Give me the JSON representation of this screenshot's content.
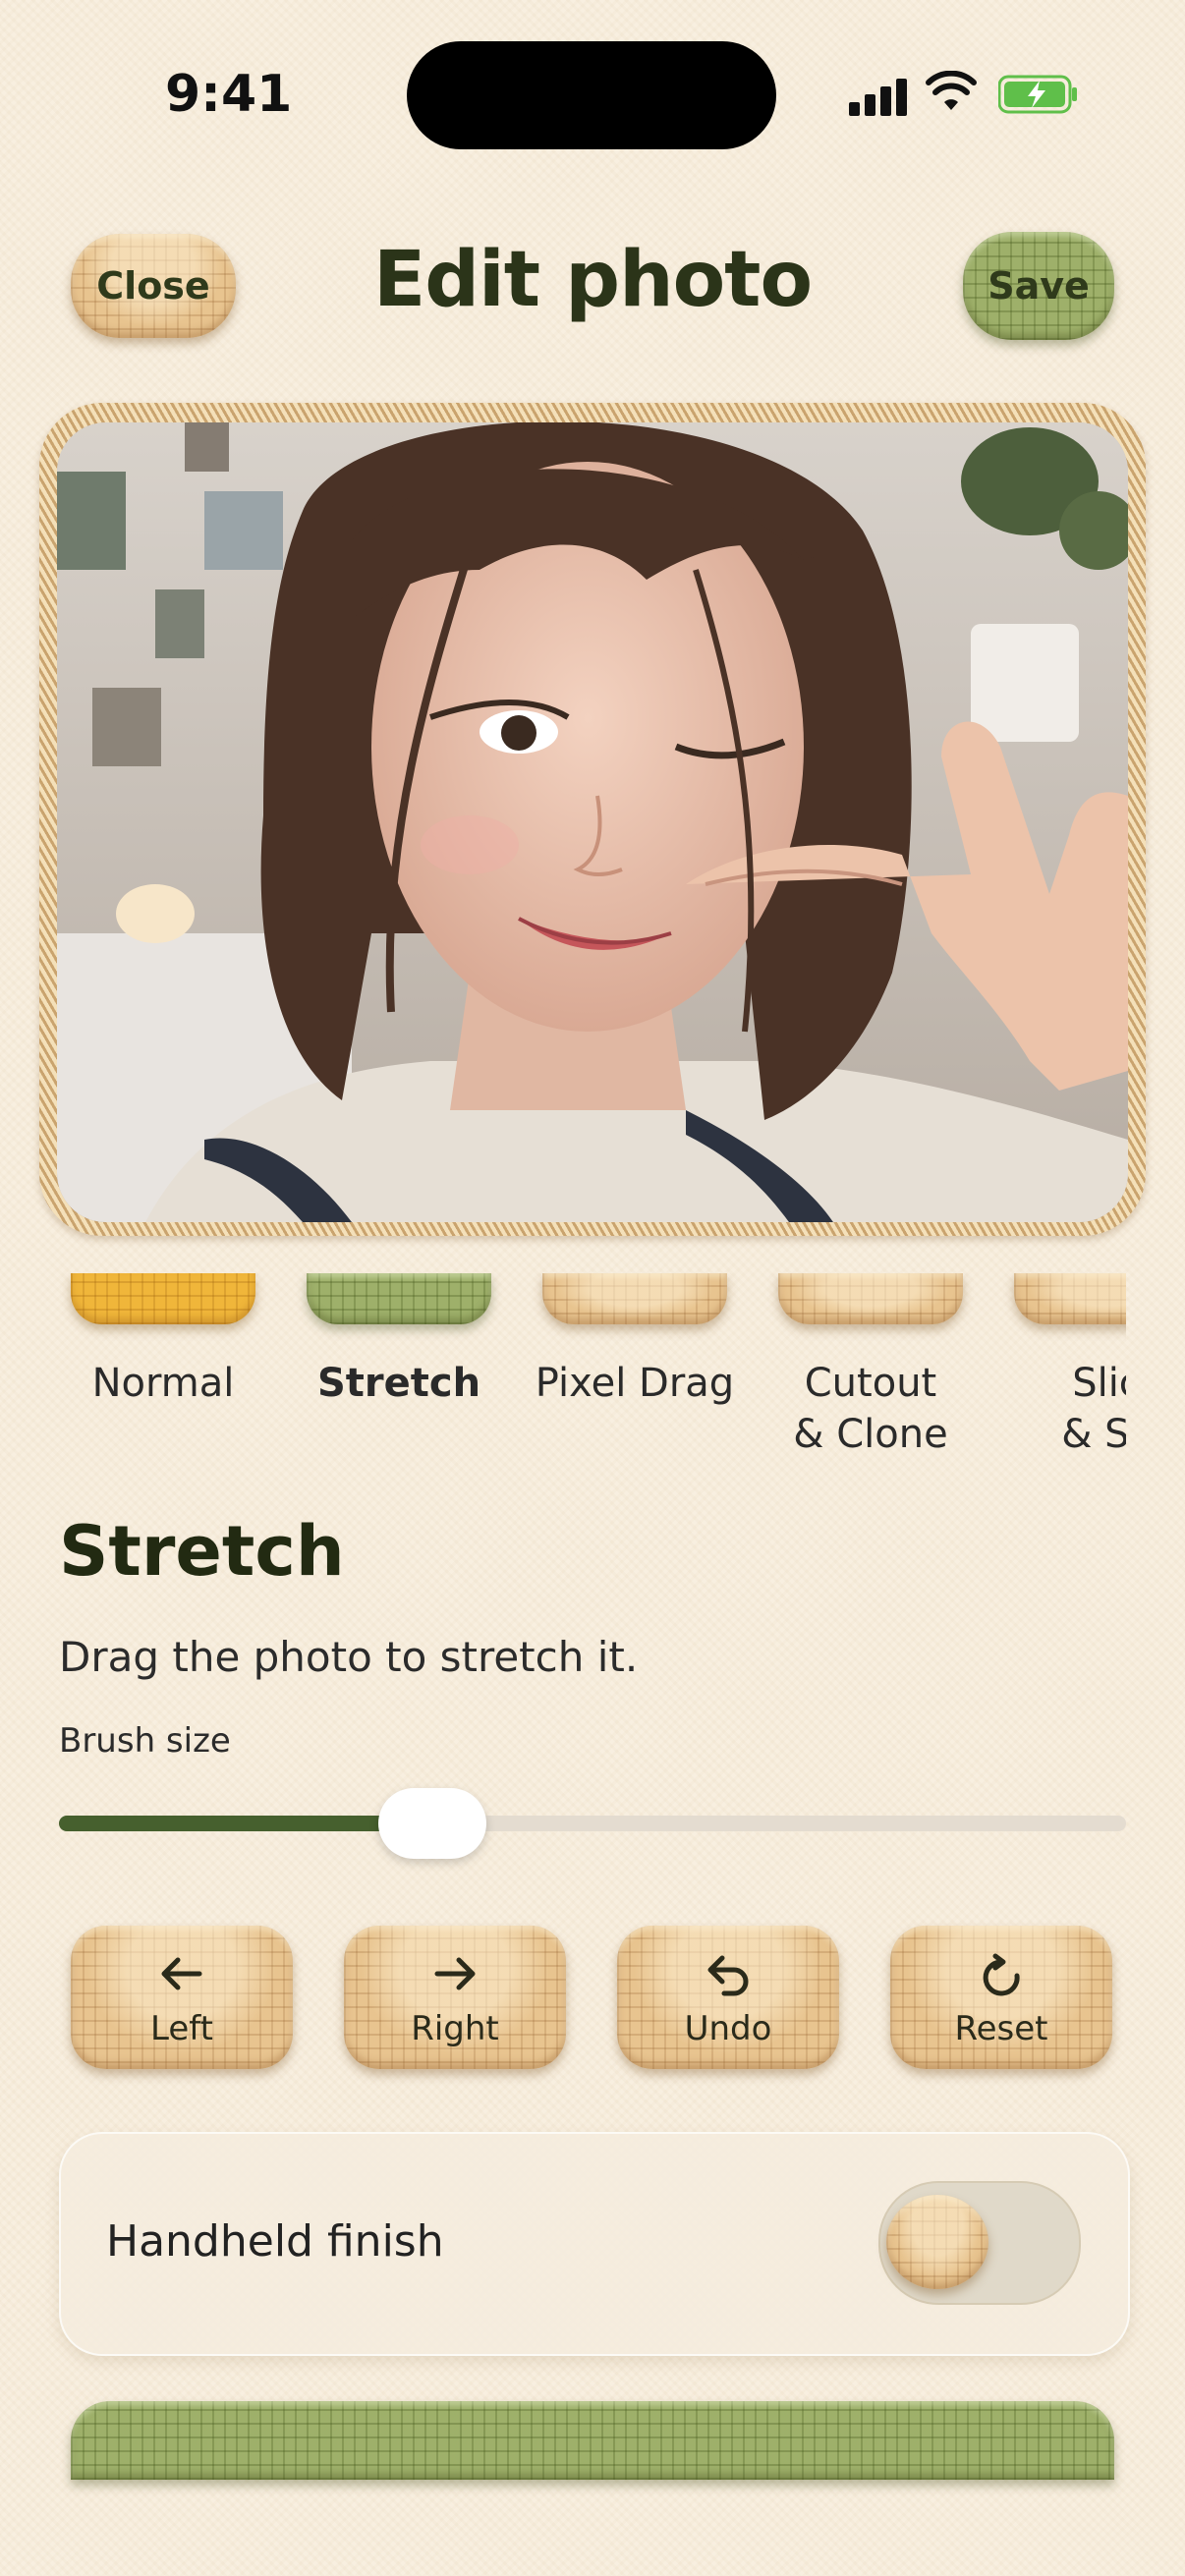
{
  "status": {
    "time": "9:41"
  },
  "header": {
    "title": "Edit photo",
    "close_label": "Close",
    "save_label": "Save"
  },
  "modes": [
    {
      "label": "Normal",
      "color": "yellow"
    },
    {
      "label": "Stretch",
      "color": "green",
      "active": true
    },
    {
      "label": "Pixel Drag",
      "color": "tan"
    },
    {
      "label": "Cutout\n& Clone",
      "color": "tan"
    },
    {
      "label": "Slic\n& Sli",
      "color": "tan"
    }
  ],
  "section": {
    "title": "Stretch",
    "description": "Drag the photo to stretch it.",
    "brush_label": "Brush size",
    "brush_value": 0.35
  },
  "actions": [
    {
      "label": "Left",
      "icon": "arrow-left-icon"
    },
    {
      "label": "Right",
      "icon": "arrow-right-icon"
    },
    {
      "label": "Undo",
      "icon": "undo-icon"
    },
    {
      "label": "Reset",
      "icon": "reset-icon"
    }
  ],
  "toggle": {
    "label": "Handheld finish",
    "on": false
  },
  "colors": {
    "accent_green": "#46602e",
    "title": "#2b3419"
  }
}
